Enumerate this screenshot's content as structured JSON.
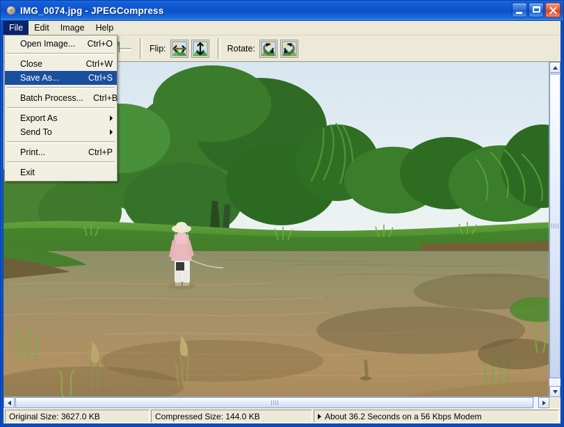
{
  "window": {
    "title": "IMG_0074.jpg - JPEGCompress",
    "app_icon": "app-disk-icon",
    "buttons": {
      "minimize": "Minimize",
      "maximize": "Maximize",
      "close": "Close"
    }
  },
  "menubar": {
    "items": [
      {
        "label": "File",
        "active": true
      },
      {
        "label": "Edit",
        "active": false
      },
      {
        "label": "Image",
        "active": false
      },
      {
        "label": "Help",
        "active": false
      }
    ]
  },
  "file_menu": {
    "items": [
      {
        "label": "Open Image...",
        "accel": "Ctrl+O",
        "selected": false,
        "submenu": false
      },
      {
        "separator": true
      },
      {
        "label": "Close",
        "accel": "Ctrl+W",
        "selected": false,
        "submenu": false
      },
      {
        "label": "Save As...",
        "accel": "Ctrl+S",
        "selected": true,
        "submenu": false
      },
      {
        "separator": true
      },
      {
        "label": "Batch Process...",
        "accel": "Ctrl+B",
        "selected": false,
        "submenu": false
      },
      {
        "separator": true
      },
      {
        "label": "Export As",
        "accel": "",
        "selected": false,
        "submenu": true
      },
      {
        "label": "Send To",
        "accel": "",
        "selected": false,
        "submenu": true
      },
      {
        "separator": true
      },
      {
        "label": "Print...",
        "accel": "Ctrl+P",
        "selected": false,
        "submenu": false
      },
      {
        "separator": true
      },
      {
        "label": "Exit",
        "accel": "",
        "selected": false,
        "submenu": false
      }
    ]
  },
  "toolbar": {
    "quality_slider": {
      "name": "quality-slider",
      "position_pct": 82
    },
    "flip_label": "Flip:",
    "rotate_label": "Rotate:",
    "flip_horizontal_icon": "flip-horizontal-icon",
    "flip_vertical_icon": "flip-vertical-icon",
    "rotate_left_icon": "rotate-left-icon",
    "rotate_right_icon": "rotate-right-icon"
  },
  "viewport": {
    "image_name": "IMG_0074.jpg",
    "scroll": {
      "vertical_thumb_pct": 96,
      "horizontal_thumb_pct": 96
    }
  },
  "statusbar": {
    "original_size": "Original Size: 3627.0 KB",
    "compressed_size": "Compressed Size: 144.0 KB",
    "modem_estimate": "About 36.2 Seconds on a 56 Kbps Modem"
  },
  "colors": {
    "title_blue": "#0d52c9",
    "menu_highlight": "#1a4f9e",
    "face": "#ece9d8",
    "close_red": "#d8472a"
  }
}
